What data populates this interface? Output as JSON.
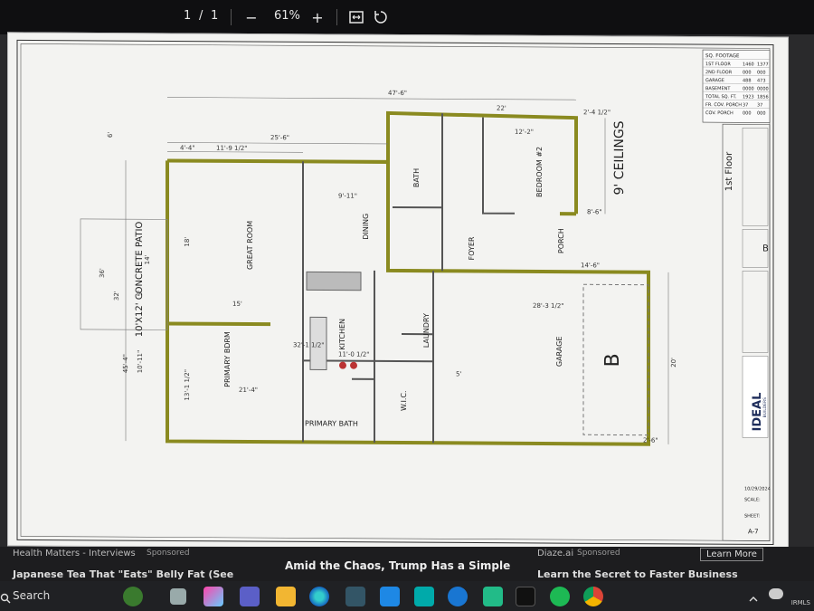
{
  "viewer": {
    "page_current": "1",
    "page_sep": "/",
    "page_total": "1",
    "zoom": "61%",
    "zoom_out": "−",
    "zoom_in": "+"
  },
  "plan": {
    "ceilings": "9' CEILINGS",
    "floor_label": "1st Floor",
    "rooms": {
      "great_room": "GREAT ROOM",
      "primary_bdrm": "PRIMARY BDRM",
      "primary_bath": "PRIMARY BATH",
      "kitchen": "KITCHEN",
      "dining": "DINING",
      "bath": "BATH",
      "bedroom2": "BEDROOM #2",
      "foyer": "FOYER",
      "porch": "PORCH",
      "laundry": "LAUNDRY",
      "wic": "W.I.C.",
      "garage": "GARAGE",
      "garage_b": "B",
      "patio": "10'X12' CONCRETE PATIO"
    },
    "dims": {
      "d1": "47'-6\"",
      "d2": "22'",
      "d3": "25'-6\"",
      "d4": "4'-4\"",
      "d5": "11'-9 1/2\"",
      "d6": "9'-11\"",
      "d7": "12'-2\"",
      "d8": "2'-4 1/2\"",
      "d9": "8'-6\"",
      "d10": "14'-6\"",
      "d11": "28'-3 1/2\"",
      "d12": "32'-1 1/2\"",
      "d13": "11'-0 1/2\"",
      "d14": "21'-4\"",
      "d15": "18'",
      "d16": "15'",
      "d17": "13'-1 1/2\"",
      "d18": "45'-4\"",
      "d19": "32'",
      "d20": "36'",
      "d21": "20'",
      "d22": "6'",
      "d23": "14'",
      "d24": "5'",
      "d25": "10'-11\"",
      "d26": "2'-6\"",
      "d27": "5'"
    },
    "table_title": "SQ. FOOTAGE",
    "table": [
      [
        "1ST FLOOR",
        "1460",
        "1377"
      ],
      [
        "2ND FLOOR",
        "000",
        "000"
      ],
      [
        "GARAGE",
        "488",
        "473"
      ],
      [
        "BASEMENT",
        "0000",
        "0000"
      ],
      [
        "TOTAL SQ. FT.",
        "1923",
        "1856"
      ],
      [
        "FR. COV. PORCH",
        "37",
        "37"
      ],
      [
        "COV. PORCH",
        "000",
        "000"
      ]
    ],
    "title_block": {
      "brand": "IDEAL",
      "brand_sub": "BUILDERS",
      "date": "10/29/2024",
      "sheet_label": "SHEET:",
      "sheet": "A-7",
      "scale_label": "SCALE:",
      "plan_letter": "B"
    }
  },
  "news": {
    "left_source": "Health Matters - Interviews",
    "left_tag": "Sponsored",
    "left_headline": "Japanese Tea That \"Eats\" Belly Fat (See",
    "center_headline": "Amid the Chaos, Trump Has a Simple",
    "right_source": "Diaze.ai",
    "right_tag": "Sponsored",
    "right_headline": "Learn the Secret to Faster Business",
    "learn_more": "Learn More"
  },
  "taskbar": {
    "search_placeholder": "Search",
    "badge": "IRMLS"
  }
}
